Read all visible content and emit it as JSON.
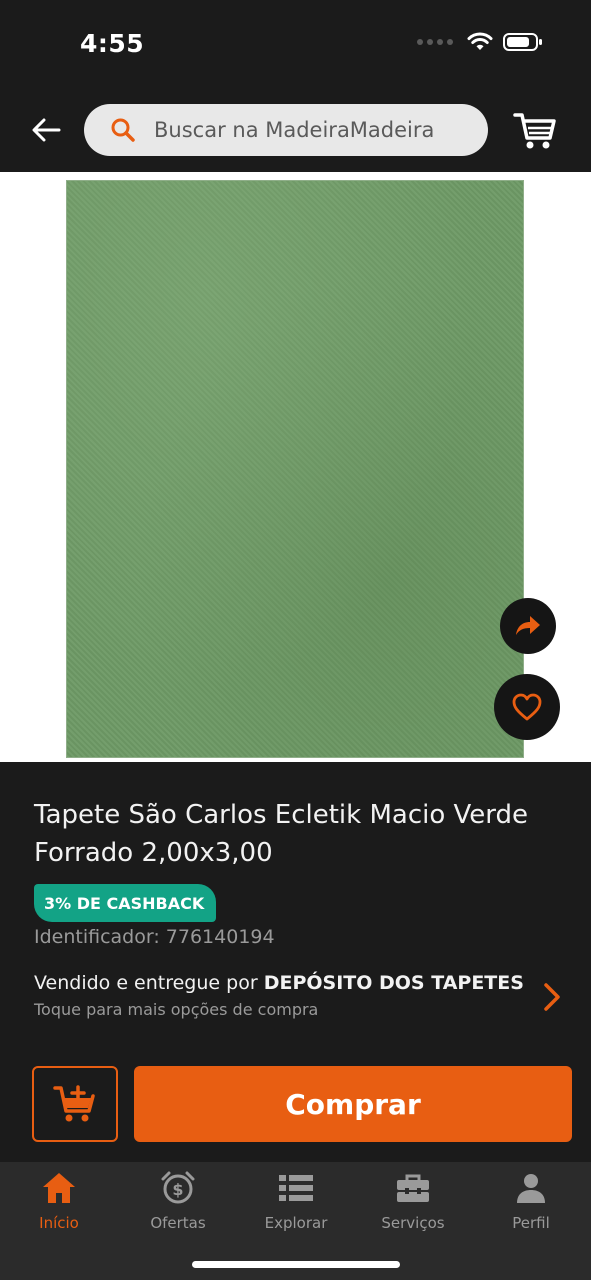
{
  "status_bar": {
    "time": "4:55"
  },
  "header": {
    "search_placeholder": "Buscar na MadeiraMadeira"
  },
  "product": {
    "title": "Tapete São Carlos Ecletik Macio Verde Forrado 2,00x3,00",
    "cashback_badge": "3% DE CASHBACK",
    "identifier": "Identificador: 776140194",
    "seller_prefix": "Vendido e entregue por ",
    "seller_name": "DEPÓSITO DOS TAPETES",
    "seller_sub": "Toque para mais opções de compra"
  },
  "actions": {
    "buy_label": "Comprar"
  },
  "tabs": [
    {
      "label": "Início",
      "icon": "home-icon",
      "active": true
    },
    {
      "label": "Ofertas",
      "icon": "alarm-dollar-icon",
      "active": false
    },
    {
      "label": "Explorar",
      "icon": "list-icon",
      "active": false
    },
    {
      "label": "Serviços",
      "icon": "toolbox-icon",
      "active": false
    },
    {
      "label": "Perfil",
      "icon": "user-icon",
      "active": false
    }
  ],
  "colors": {
    "accent": "#e85e12",
    "cashback": "#13a386",
    "background": "#1b1b1b",
    "tab_bar": "#2b2b2b"
  }
}
